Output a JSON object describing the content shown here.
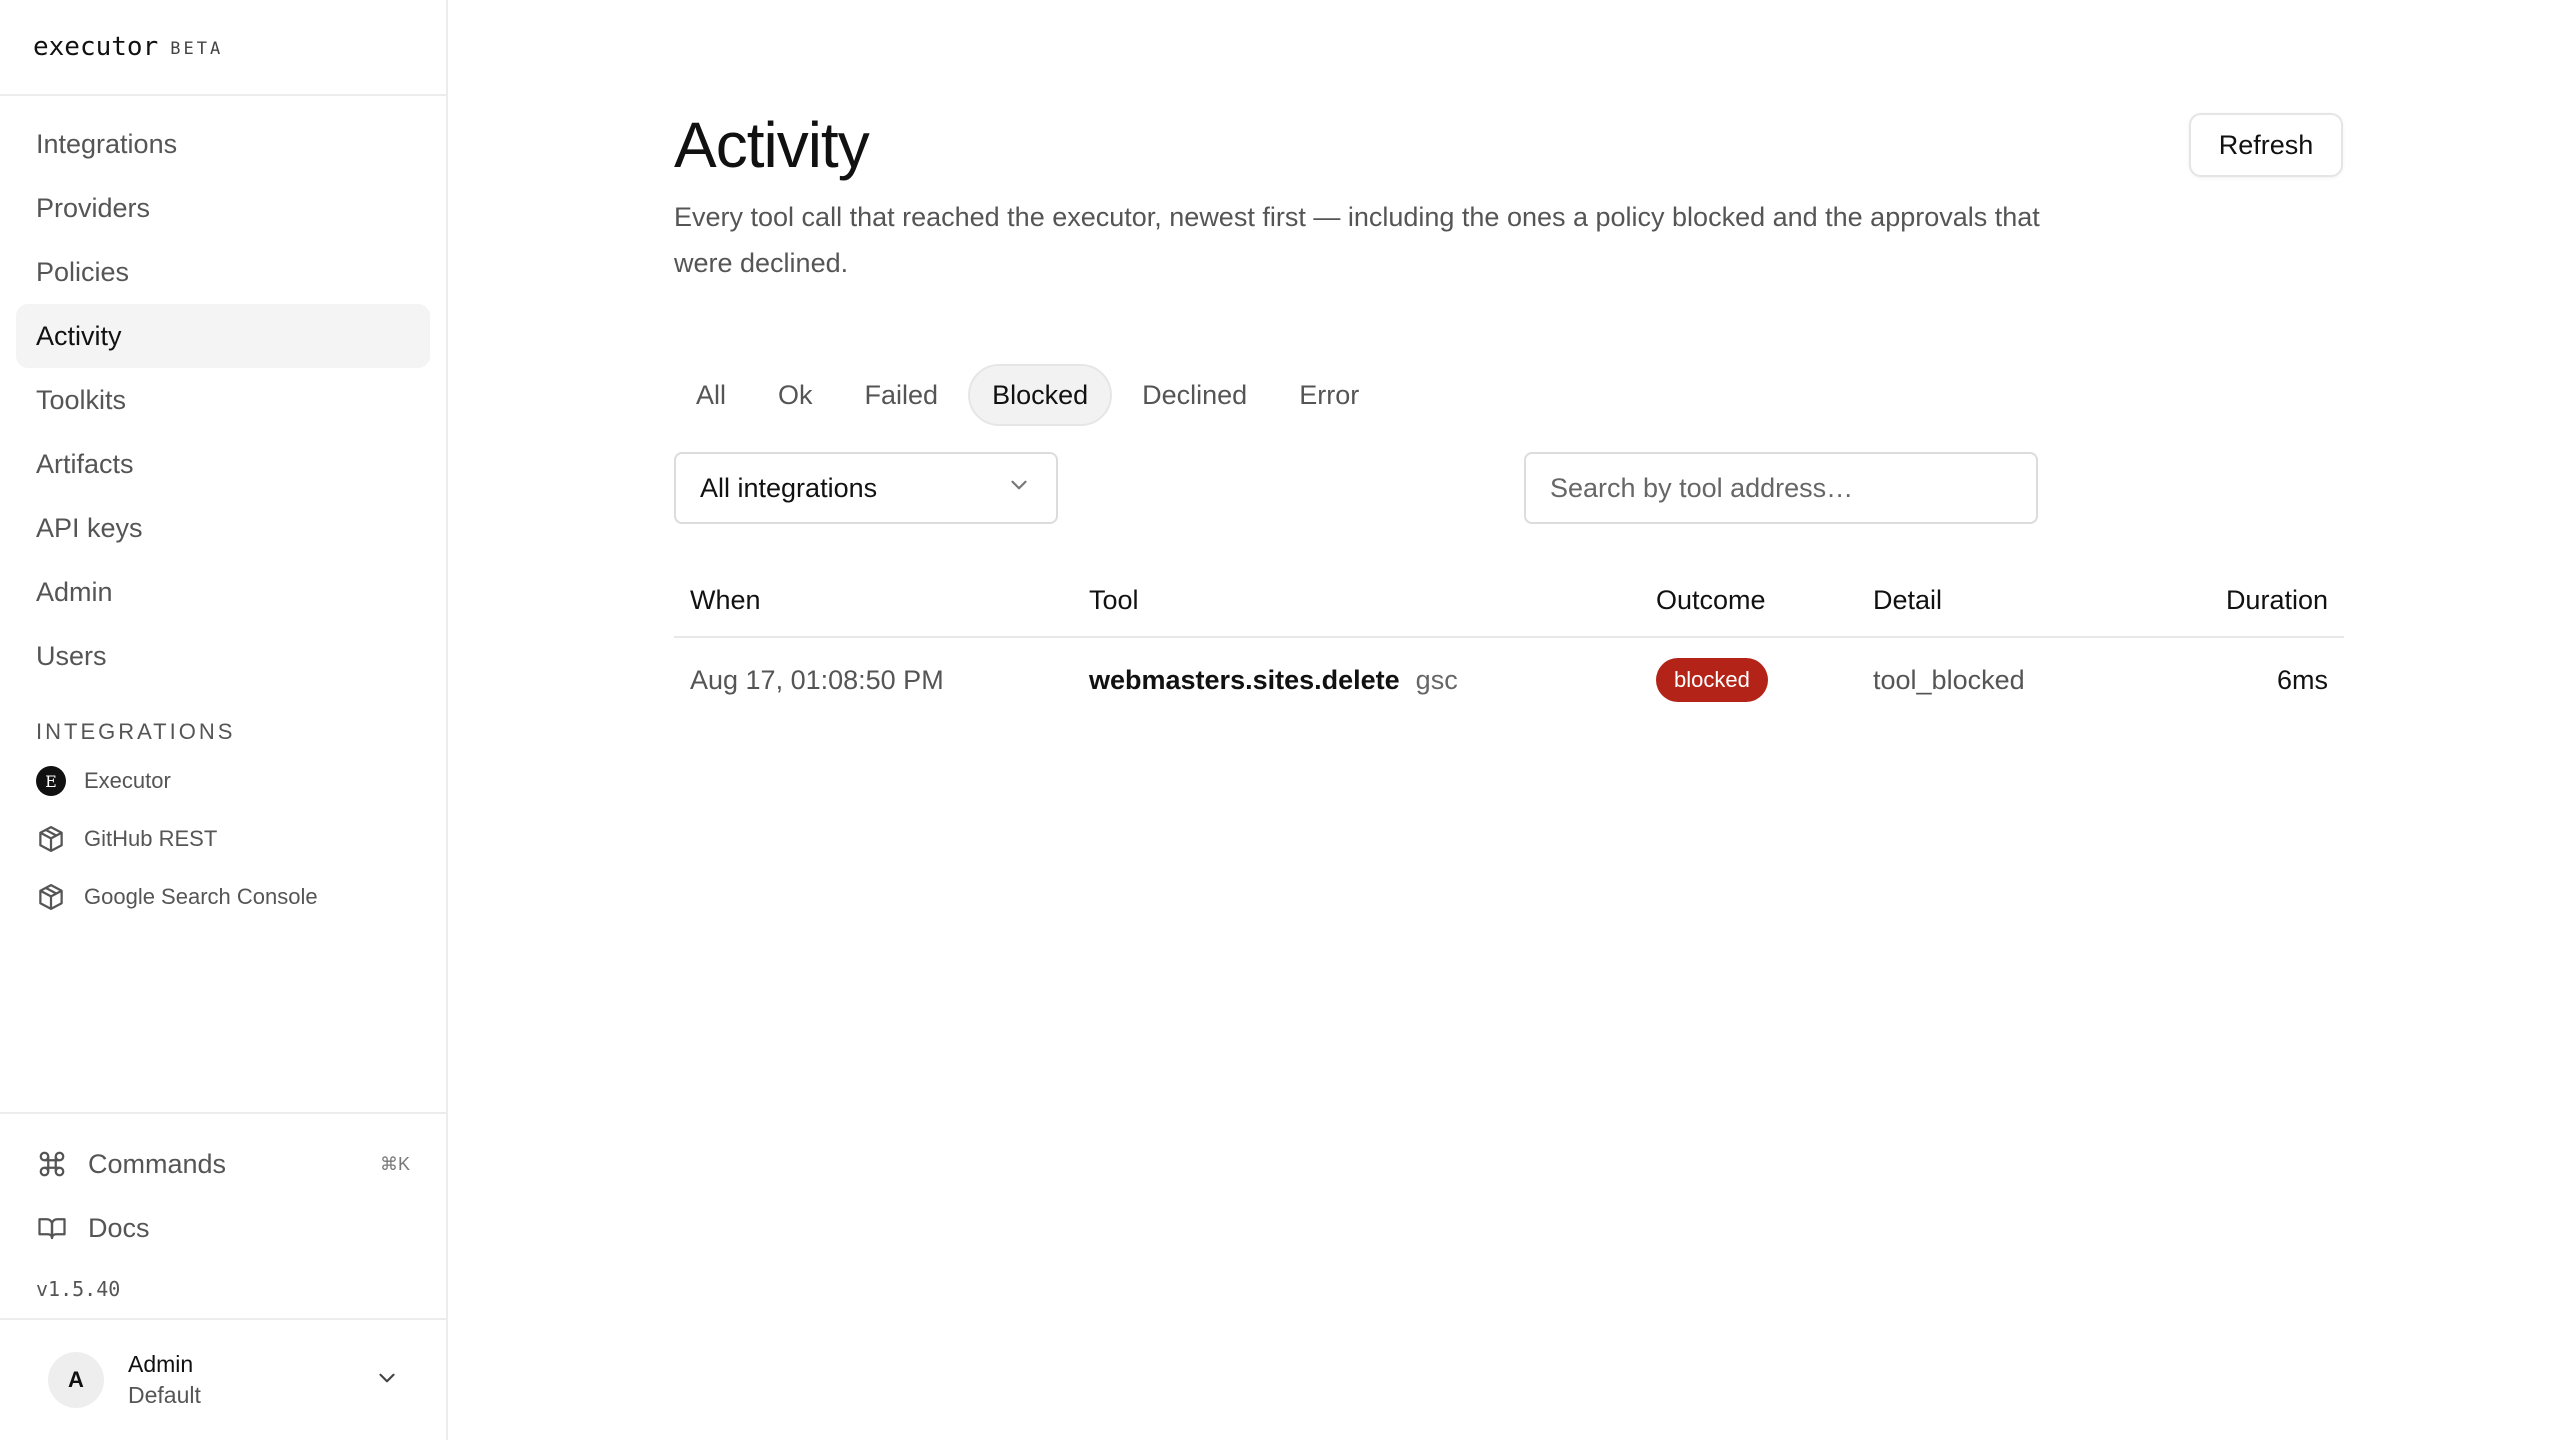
{
  "brand": {
    "name": "executor",
    "tag": "BETA"
  },
  "sidebar": {
    "nav": [
      {
        "label": "Integrations",
        "active": false
      },
      {
        "label": "Providers",
        "active": false
      },
      {
        "label": "Policies",
        "active": false
      },
      {
        "label": "Activity",
        "active": true
      },
      {
        "label": "Toolkits",
        "active": false
      },
      {
        "label": "Artifacts",
        "active": false
      },
      {
        "label": "API keys",
        "active": false
      },
      {
        "label": "Admin",
        "active": false
      },
      {
        "label": "Users",
        "active": false
      }
    ],
    "integrations_label": "INTEGRATIONS",
    "integrations": [
      {
        "label": "Executor",
        "icon": "executor-logo-icon"
      },
      {
        "label": "GitHub REST",
        "icon": "package-icon"
      },
      {
        "label": "Google Search Console",
        "icon": "package-icon"
      }
    ],
    "commands_label": "Commands",
    "commands_shortcut": "⌘K",
    "docs_label": "Docs",
    "version": "v1.5.40",
    "user": {
      "initial": "A",
      "name": "Admin",
      "workspace": "Default"
    }
  },
  "header": {
    "title": "Activity",
    "description": "Every tool call that reached the executor, newest first — including the ones a policy blocked and the approvals that were declined.",
    "refresh_label": "Refresh"
  },
  "tabs": [
    {
      "label": "All",
      "active": false
    },
    {
      "label": "Ok",
      "active": false
    },
    {
      "label": "Failed",
      "active": false
    },
    {
      "label": "Blocked",
      "active": true
    },
    {
      "label": "Declined",
      "active": false
    },
    {
      "label": "Error",
      "active": false
    }
  ],
  "filters": {
    "integration_selected": "All integrations",
    "search_placeholder": "Search by tool address…",
    "search_value": ""
  },
  "table": {
    "columns": [
      "When",
      "Tool",
      "Outcome",
      "Detail",
      "Duration"
    ],
    "rows": [
      {
        "when": "Aug 17, 01:08:50 PM",
        "tool": "webmasters.sites.delete",
        "namespace": "gsc",
        "outcome": "blocked",
        "detail": "tool_blocked",
        "duration": "6ms"
      }
    ]
  },
  "colors": {
    "blocked_badge": "#b42318",
    "active_nav_bg": "#f4f4f4",
    "border": "#ececec"
  }
}
